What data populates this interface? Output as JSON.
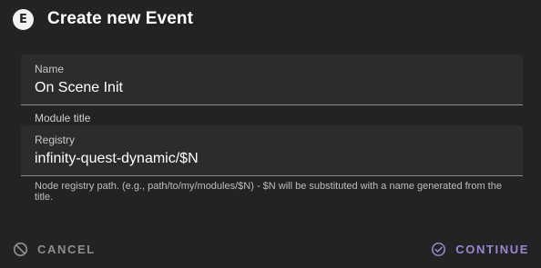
{
  "dialog": {
    "badge": "E",
    "title": "Create new Event"
  },
  "fields": {
    "name": {
      "label": "Name",
      "value": "On Scene Init"
    },
    "module_title": {
      "label": "Module title"
    },
    "registry": {
      "label": "Registry",
      "value": "infinity-quest-dynamic/$N",
      "helper": "Node registry path. (e.g., path/to/my/modules/$N) - $N will be substituted with a name generated from the title."
    }
  },
  "actions": {
    "cancel_label": "CANCEL",
    "continue_label": "CONTINUE"
  },
  "icons": {
    "cancel": "block-icon",
    "continue": "check-circle-icon"
  },
  "colors": {
    "background": "#232323",
    "field_background": "#2c2c2c",
    "accent": "#9a86d4",
    "muted": "#8d8d8d"
  }
}
